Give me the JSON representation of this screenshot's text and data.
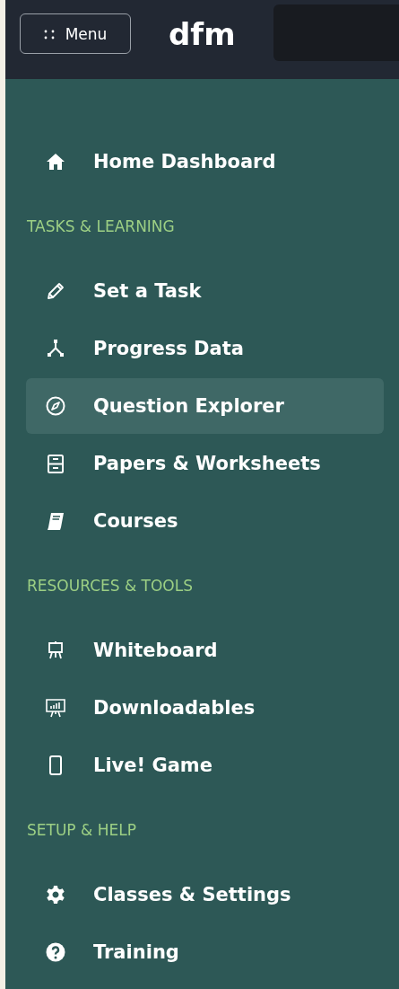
{
  "header": {
    "menu_button": {
      "label": "Menu"
    },
    "logo": "dfm"
  },
  "home": {
    "label": "Home Dashboard",
    "selected": false
  },
  "sections": [
    {
      "title": "TASKS & LEARNING",
      "items": [
        {
          "label": "Set a Task",
          "selected": false
        },
        {
          "label": "Progress Data",
          "selected": false
        },
        {
          "label": "Question Explorer",
          "selected": true
        },
        {
          "label": "Papers & Worksheets",
          "selected": false
        },
        {
          "label": "Courses",
          "selected": false
        }
      ]
    },
    {
      "title": "RESOURCES & TOOLS",
      "items": [
        {
          "label": "Whiteboard",
          "selected": false
        },
        {
          "label": "Downloadables",
          "selected": false
        },
        {
          "label": "Live! Game",
          "selected": false
        }
      ]
    },
    {
      "title": "SETUP & HELP",
      "items": [
        {
          "label": "Classes & Settings",
          "selected": false
        },
        {
          "label": "Training",
          "selected": false
        }
      ]
    }
  ]
}
